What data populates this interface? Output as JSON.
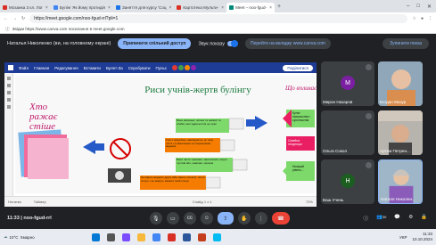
{
  "browser": {
    "tabs": [
      {
        "label": "Мозаика 3 кл. Лог",
        "color": "#d93025"
      },
      {
        "label": "Булінг Як йому протидія",
        "color": "#4285f4"
      },
      {
        "label": "Заняття для курсу 'Соц",
        "color": "#1a73e8"
      },
      {
        "label": "Картотека Мульти-",
        "color": "#d93025"
      },
      {
        "label": "Meet – noo-fgud-",
        "color": "#00897b"
      }
    ],
    "url": "https://meet.google.com/noo-fgud-rrl?pli=1",
    "bookmark": "Звідки https://www.canva.com посилання в meet.google.com"
  },
  "share_bar": {
    "presenter": "Наталья Николенко (ви, на головному екрані)",
    "stop_label": "Припинити спільний доступ",
    "sound_label": "Звук показу",
    "switch_label": "Перейти на вкладку www.canva.com",
    "stop_show_label": "Зупинити показ"
  },
  "presentation": {
    "menu_items": [
      "Файл",
      "Главная",
      "Редагування",
      "Вставити",
      "Булет-За",
      "Спробувати",
      "Пульс"
    ],
    "share_label": "Поділитися",
    "slide_title": "Риси учнів-жертв булінгу",
    "left_text": "Хто ражає стіше",
    "right_title": "Що впливає",
    "boxes": [
      "Вони маленькі, погано та невмілі та слабкі, інші здаються їм це хуже",
      "Учні з хворобою, інвалідністю, (в тому числі з її фізичними чи соціальними вадами)",
      "Вони часто тривожні, занепокоєні, надто чутливі або, навпаки, скромні",
      "Не мають жодного друга (або мають кількох), які не хочуть / не можуть змінити їхній статус"
    ],
    "right_boxes": [
      "Культ насильства і суспільства",
      "Сімейна тенденція",
      "Низький рівень..."
    ],
    "status": "Слайд 1 з 1",
    "notes_label": "Нотатки",
    "timer_label": "Таймер",
    "zoom": "72%"
  },
  "participants": [
    {
      "name": "Мирон Назаров",
      "initial": "М",
      "color": "#7b1fa2",
      "type": "avatar"
    },
    {
      "name": "Богдан Мазур",
      "type": "photo"
    },
    {
      "name": "Ольга Сокол",
      "type": "blank"
    },
    {
      "name": "Артем Петрен...",
      "type": "photo"
    },
    {
      "name": "Ваш Учень",
      "initial": "Н",
      "color": "#1b5e20",
      "type": "avatar"
    },
    {
      "name": "Наталя Николен...",
      "type": "photo"
    }
  ],
  "controls": {
    "meeting_code": "11:33 | noo-fgud-rrl",
    "participants_count": "30"
  },
  "taskbar": {
    "weather_temp": "10°C",
    "weather_desc": "Хмарно",
    "time": "11:33",
    "date": "10.10.2024",
    "lang": "УКР"
  }
}
